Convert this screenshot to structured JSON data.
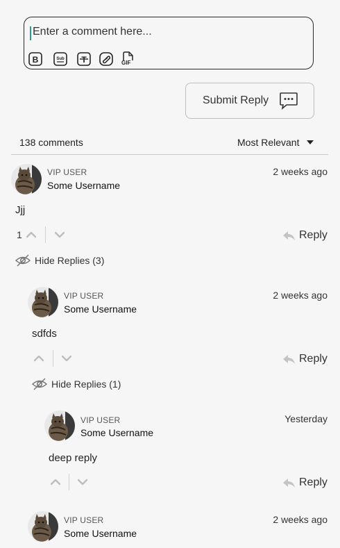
{
  "editor": {
    "placeholder": "Enter a comment here...",
    "tools": [
      "bold-icon",
      "subscript-icon",
      "strikethrough-icon",
      "attachment-icon",
      "gif-icon"
    ],
    "gif_label": "GIF"
  },
  "submit": {
    "label": "Submit Reply",
    "icon": "chat-bubble-icon"
  },
  "comments_header": {
    "count_label": "138 comments",
    "sort_label": "Most Relevant"
  },
  "comments": [
    {
      "badge": "VIP USER",
      "username": "Some Username",
      "time": "2 weeks ago",
      "body": "Jjj",
      "votes": "1",
      "reply_label": "Reply",
      "hide_label": "Hide Replies (3)"
    },
    {
      "badge": "VIP USER",
      "username": "Some Username",
      "time": "2 weeks ago",
      "body": "sdfds",
      "reply_label": "Reply",
      "hide_label": "Hide Replies (1)"
    },
    {
      "badge": "VIP USER",
      "username": "Some Username",
      "time": "Yesterday",
      "body": "deep reply",
      "reply_label": "Reply"
    },
    {
      "badge": "VIP USER",
      "username": "Some Username",
      "time": "2 weeks ago"
    }
  ],
  "colors": {
    "caret": "#2a9d8f",
    "background": "#f6f6f6",
    "border": "#2a2a2a"
  }
}
